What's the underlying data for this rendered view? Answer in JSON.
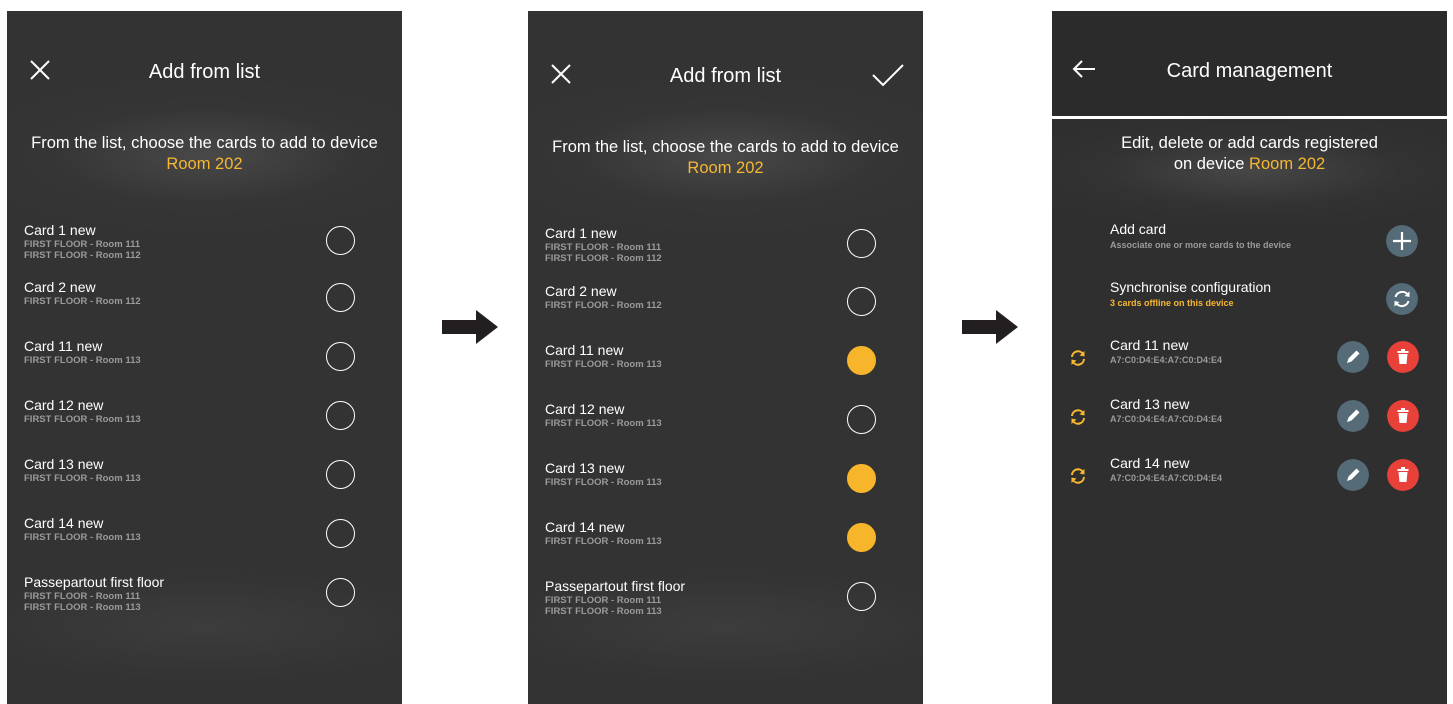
{
  "colors": {
    "accent": "#f7b731",
    "screen_bg": "#333333",
    "edit": "#566b78",
    "delete": "#e8413a"
  },
  "screen1": {
    "title": "Add from list",
    "subtitle_pre": "From the list, choose the cards to add to device",
    "subtitle_device": "Room 202",
    "items": [
      {
        "name": "Card 1 new",
        "lines": [
          "FIRST FLOOR - Room 111",
          "FIRST FLOOR - Room 112"
        ],
        "selected": false
      },
      {
        "name": "Card 2 new",
        "lines": [
          "FIRST FLOOR - Room 112"
        ],
        "selected": false
      },
      {
        "name": "Card 11 new",
        "lines": [
          "FIRST FLOOR - Room 113"
        ],
        "selected": false
      },
      {
        "name": "Card 12 new",
        "lines": [
          "FIRST FLOOR - Room 113"
        ],
        "selected": false
      },
      {
        "name": "Card 13 new",
        "lines": [
          "FIRST FLOOR - Room 113"
        ],
        "selected": false
      },
      {
        "name": "Card 14 new",
        "lines": [
          "FIRST FLOOR - Room 113"
        ],
        "selected": false
      },
      {
        "name": "Passepartout first floor",
        "lines": [
          "FIRST FLOOR - Room 111",
          "FIRST FLOOR - Room 113"
        ],
        "selected": false
      }
    ]
  },
  "screen2": {
    "title": "Add from list",
    "subtitle_pre": "From the list, choose the cards to add to device",
    "subtitle_device": "Room 202",
    "items": [
      {
        "name": "Card 1 new",
        "lines": [
          "FIRST FLOOR - Room 111",
          "FIRST FLOOR - Room 112"
        ],
        "selected": false
      },
      {
        "name": "Card 2 new",
        "lines": [
          "FIRST FLOOR - Room 112"
        ],
        "selected": false
      },
      {
        "name": "Card 11 new",
        "lines": [
          "FIRST FLOOR - Room 113"
        ],
        "selected": true
      },
      {
        "name": "Card 12 new",
        "lines": [
          "FIRST FLOOR - Room 113"
        ],
        "selected": false
      },
      {
        "name": "Card 13 new",
        "lines": [
          "FIRST FLOOR - Room 113"
        ],
        "selected": true
      },
      {
        "name": "Card 14 new",
        "lines": [
          "FIRST FLOOR - Room 113"
        ],
        "selected": true
      },
      {
        "name": "Passepartout first floor",
        "lines": [
          "FIRST FLOOR - Room 111",
          "FIRST FLOOR - Room 113"
        ],
        "selected": false
      }
    ]
  },
  "screen3": {
    "title": "Card management",
    "subtitle_line1": "Edit, delete or add cards registered",
    "subtitle_line2_pre": "on device",
    "subtitle_device": "Room 202",
    "add_card": {
      "label": "Add card",
      "sub": "Associate one or more cards to the device"
    },
    "sync": {
      "label": "Synchronise configuration",
      "sub": "3 cards offline on this device"
    },
    "cards": [
      {
        "name": "Card 11 new",
        "code": "A7:C0:D4:E4:A7:C0:D4:E4"
      },
      {
        "name": "Card 13 new",
        "code": "A7:C0:D4:E4:A7:C0:D4:E4"
      },
      {
        "name": "Card 14 new",
        "code": "A7:C0:D4:E4:A7:C0:D4:E4"
      }
    ]
  }
}
